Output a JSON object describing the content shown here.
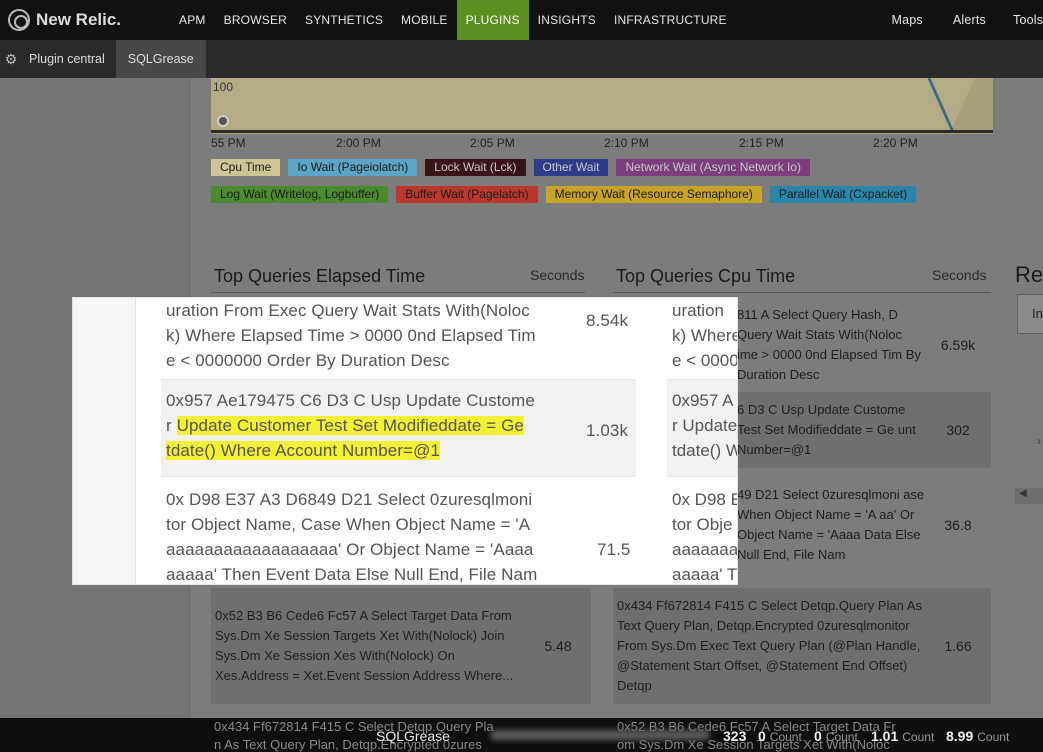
{
  "nav": {
    "brand": "New Relic.",
    "items": [
      "APM",
      "BROWSER",
      "SYNTHETICS",
      "MOBILE",
      "PLUGINS",
      "INSIGHTS",
      "INFRASTRUCTURE"
    ],
    "active": "PLUGINS",
    "right": [
      "Maps",
      "Alerts",
      "Tools"
    ]
  },
  "subnav": {
    "items": [
      "Plugin central",
      "SQLGrease"
    ]
  },
  "chart": {
    "y_tick": "100",
    "x_ticks": [
      "55 PM",
      "2:00 PM",
      "2:05 PM",
      "2:10 PM",
      "2:15 PM",
      "2:20 PM"
    ],
    "legend_row1": [
      {
        "label": "Cpu Time",
        "color": "#cfc697"
      },
      {
        "label": "Io Wait (Pageiolatch)",
        "color": "#5aa6c4"
      },
      {
        "label": "Lock Wait (Lck)",
        "color": "#3a1414"
      },
      {
        "label": "Other Wait",
        "color": "#2c3c8a"
      },
      {
        "label": "Network Wait (Async Network Io)",
        "color": "#7c3e7e"
      }
    ],
    "legend_row2": [
      {
        "label": "Log Wait (Writelog, Logbuffer)",
        "color": "#4b8a2e"
      },
      {
        "label": "Buffer Wait (Pagelatch)",
        "color": "#b9372c"
      },
      {
        "label": "Memory Wait (Resource Semaphore)",
        "color": "#c7a326"
      },
      {
        "label": "Parallel Wait (Cxpacket)",
        "color": "#2a86a8"
      }
    ]
  },
  "elapsed": {
    "title": "Top Queries Elapsed Time",
    "unit": "Seconds",
    "rows": [
      {
        "text": "0x52 B3 B6 Cede6 Fc57 A Select Target Data From Sys.Dm Xe Session Targets Xet With(Nolock) Join Sys.Dm Xe Session Xes With(Nolock) On Xes.Address = Xet.Event Session Address Where...",
        "value": "5.48"
      }
    ]
  },
  "cpu": {
    "title": "Top Queries Cpu Time",
    "unit": "Seconds",
    "rows": [
      {
        "text": "811 A Select Query Hash, D Query Wait Stats With(Noloc ime > 0000 0nd Elapsed Tim By Duration Desc",
        "value": "6.59k"
      },
      {
        "text": "6 D3 C Usp Update Custome Test Set Modifieddate = Ge unt Number=@1",
        "value": "302"
      },
      {
        "text": "49 D21 Select 0zuresqlmoni ase When Object Name = 'A aa' Or Object Name = 'Aaaa Data Else Null End, File Nam",
        "value": "36.8"
      },
      {
        "text": "0x434 Ff672814 F415 C Select Detqp.Query Plan As Text Query Plan, Detqp.Encrypted 0zuresqlmonitor From Sys.Dm Exec Text Query Plan (@Plan Handle, @Statement Start Offset, @Statement End Offset) Detqp",
        "value": "1.66"
      }
    ]
  },
  "side": {
    "title": "Re",
    "box": "In"
  },
  "zoom": {
    "rows": [
      {
        "text": "uration From Exec Query Wait Stats With(Nolock) Where Elapsed Time > 0000 0nd Elapsed Time < 0000000 Order By Duration Desc",
        "line1": "uration From Exec Query Wait Stats With(Noloc",
        "line2": "k) Where Elapsed Time > 0000 0nd Elapsed Tim",
        "line3": "e < 0000000 Order By Duration Desc",
        "value": "8.54k"
      },
      {
        "line1": "0x957 Ae179475 C6 D3 C Usp Update Custome",
        "line2a": "r ",
        "line2b": "Update Customer Test Set Modifieddate = Ge",
        "line3": "tdate() Where Account Number=@1",
        "value": "1.03k"
      },
      {
        "line1": "0x D98 E37 A3 D6849 D21 Select 0zuresqlmoni",
        "line2": "tor Object Name, Case When Object Name = 'A",
        "line3": "aaaaaaaaaaaaaaaaaa' Or Object Name = 'Aaaa",
        "line4": "aaaaa' Then Event Data Else Null End, File Nam",
        "value": "71.5"
      }
    ],
    "col2": [
      {
        "line1": "uration",
        "line2": "k) Where",
        "line3": "e < 0000"
      },
      {
        "line1": "0x957 A",
        "line2": "r Update",
        "line3": "tdate() W"
      },
      {
        "line1": "0x D98 E",
        "line2": "tor Obje",
        "line3": "aaaaaaaa",
        "line4": "aaaaa' T"
      }
    ]
  },
  "bottom": {
    "title": "SQLGrease",
    "overlay_left": "0x434 Ff672814 F415 C Select Detqp.Query Pla",
    "overlay_left2": "n As Text Query Plan, Detqp.Encrypted 0zures",
    "overlay_right": "0x52 B3 B6 Cede6 Fc57 A Select Target Data Fr",
    "overlay_right2": "om Sys.Dm Xe Session Targets Xet With(Noloc",
    "stats": [
      {
        "n": "323",
        "u": ""
      },
      {
        "n": "0",
        "u": "Count"
      },
      {
        "n": "0",
        "u": "Count"
      },
      {
        "n": "1.01",
        "u": "Count"
      },
      {
        "n": "8.99",
        "u": "Count"
      }
    ]
  }
}
